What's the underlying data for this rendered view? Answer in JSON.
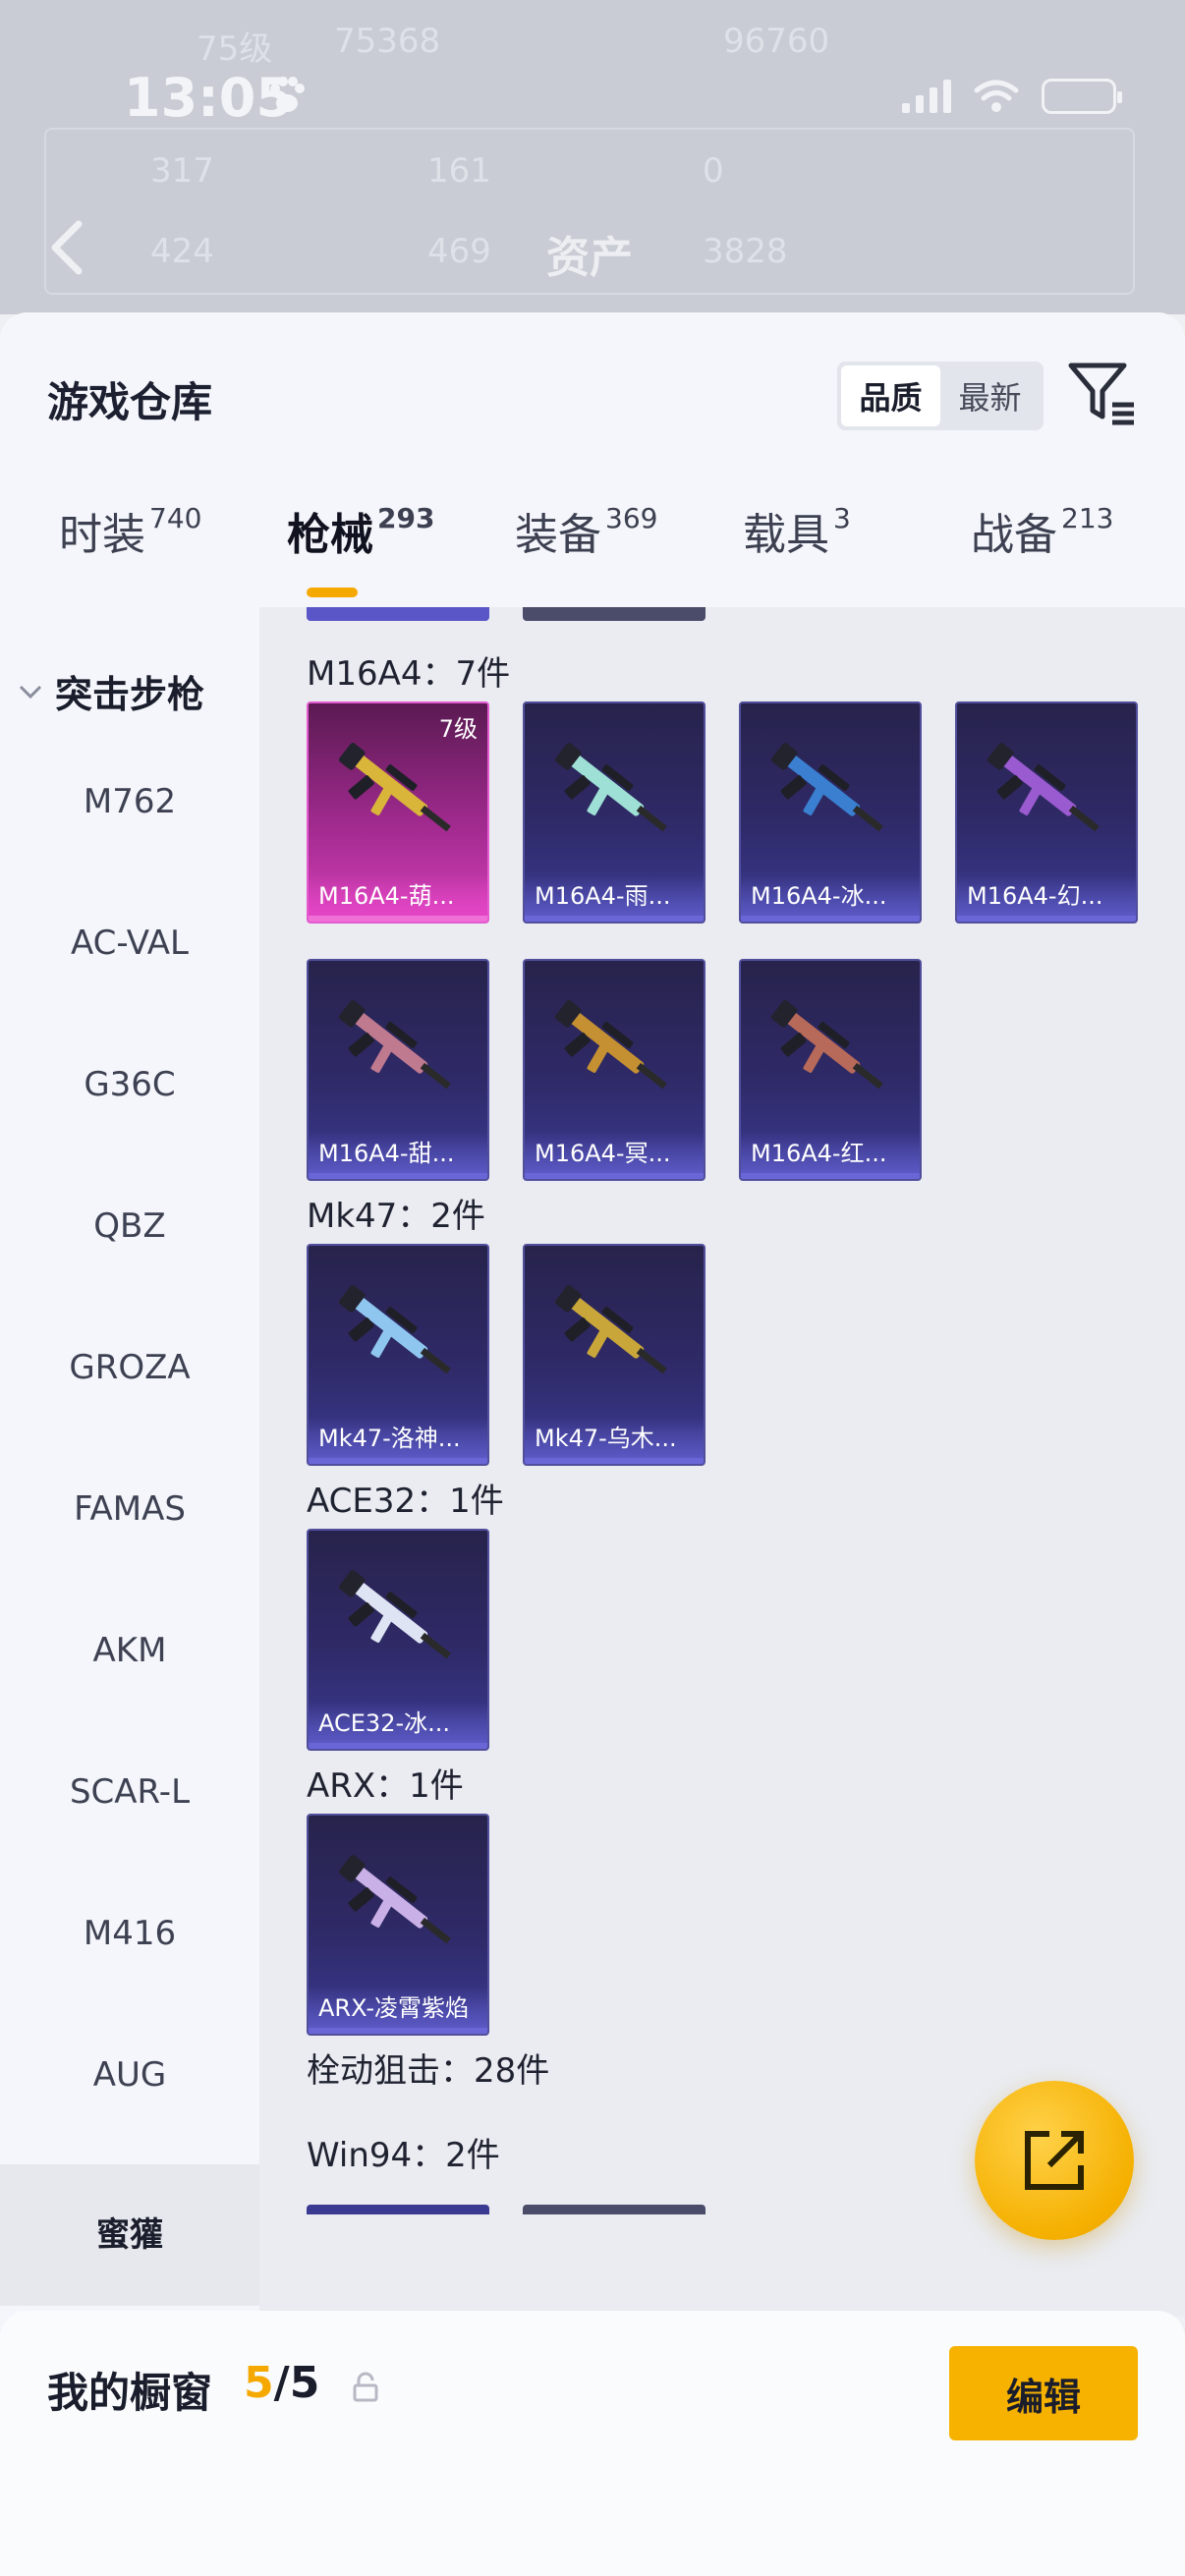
{
  "status_bar": {
    "time": "13:05"
  },
  "background_header": {
    "title": "资产",
    "faint_stats": [
      "75级",
      "75368",
      "96760",
      "317",
      "161",
      "0",
      "424",
      "469",
      "3828"
    ]
  },
  "warehouse": {
    "title": "游戏仓库",
    "sort_options": [
      "品质",
      "最新"
    ],
    "sort_selected": "品质",
    "tabs": [
      {
        "label": "时装",
        "count": "740"
      },
      {
        "label": "枪械",
        "count": "293"
      },
      {
        "label": "装备",
        "count": "369"
      },
      {
        "label": "载具",
        "count": "3"
      },
      {
        "label": "战备",
        "count": "213"
      }
    ],
    "active_tab": "枪械"
  },
  "sidebar": {
    "group_label": "突击步枪",
    "items": [
      "M762",
      "AC-VAL",
      "G36C",
      "QBZ",
      "GROZA",
      "FAMAS",
      "AKM",
      "SCAR-L",
      "M416",
      "AUG",
      "蜜獾"
    ],
    "selected": "蜜獾"
  },
  "content": {
    "groups": [
      {
        "label": "M16A4：7件",
        "items": [
          {
            "name": "M16A4-葫...",
            "level": "7级",
            "rarity": "legendary",
            "gun_color": "#d9b53a"
          },
          {
            "name": "M16A4-雨...",
            "rarity": "epic",
            "gun_color": "#9fe0d6"
          },
          {
            "name": "M16A4-冰...",
            "rarity": "epic",
            "gun_color": "#3a7fd0"
          },
          {
            "name": "M16A4-幻...",
            "rarity": "epic",
            "gun_color": "#9a5ad0"
          },
          {
            "name": "M16A4-甜...",
            "rarity": "epic",
            "gun_color": "#c07a90"
          },
          {
            "name": "M16A4-冥...",
            "rarity": "epic",
            "gun_color": "#c49032"
          },
          {
            "name": "M16A4-红...",
            "rarity": "epic",
            "gun_color": "#b86a5a"
          }
        ]
      },
      {
        "label": "Mk47：2件",
        "items": [
          {
            "name": "Mk47-洛神...",
            "rarity": "epic",
            "gun_color": "#8fc6f0"
          },
          {
            "name": "Mk47-乌木...",
            "rarity": "epic",
            "gun_color": "#c9a63a"
          }
        ]
      },
      {
        "label": "ACE32：1件",
        "items": [
          {
            "name": "ACE32-冰...",
            "rarity": "epic",
            "gun_color": "#dfe4f4"
          }
        ]
      },
      {
        "label": "ARX：1件",
        "items": [
          {
            "name": "ARX-凌霄紫焰",
            "rarity": "epic",
            "gun_color": "#c9b0e6"
          }
        ]
      },
      {
        "label": "栓动狙击：28件",
        "items": []
      },
      {
        "label": "Win94：2件",
        "items": []
      }
    ]
  },
  "showcase": {
    "label": "我的橱窗",
    "current": "5",
    "separator": "/",
    "total": "5",
    "edit_label": "编辑"
  },
  "colors": {
    "accent": "#f5a900",
    "legendary": "#d43fb7",
    "epic": "#3b3a93"
  }
}
